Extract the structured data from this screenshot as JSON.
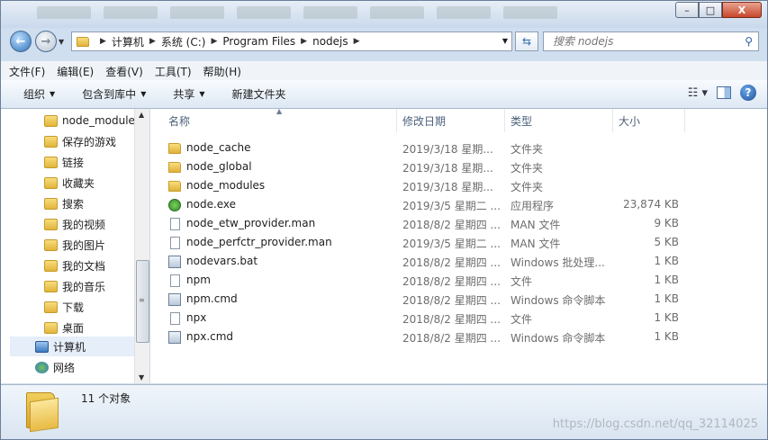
{
  "window": {
    "caption_buttons": [
      "–",
      "□",
      "X"
    ]
  },
  "address": {
    "crumbs": [
      "计算机",
      "系统 (C:)",
      "Program Files",
      "nodejs"
    ],
    "search_placeholder": "搜索 nodejs"
  },
  "menu": [
    "文件(F)",
    "编辑(E)",
    "查看(V)",
    "工具(T)",
    "帮助(H)"
  ],
  "toolbar": {
    "organize": "组织",
    "include_library": "包含到库中",
    "share": "共享",
    "new_folder": "新建文件夹"
  },
  "nav": {
    "items": [
      {
        "label": "node_module",
        "icon": "folder-icon"
      },
      {
        "label": "保存的游戏",
        "icon": "folder-icon"
      },
      {
        "label": "链接",
        "icon": "folder-icon"
      },
      {
        "label": "收藏夹",
        "icon": "folder-icon"
      },
      {
        "label": "搜索",
        "icon": "folder-icon"
      },
      {
        "label": "我的视频",
        "icon": "folder-icon"
      },
      {
        "label": "我的图片",
        "icon": "folder-icon"
      },
      {
        "label": "我的文档",
        "icon": "folder-icon"
      },
      {
        "label": "我的音乐",
        "icon": "folder-icon"
      },
      {
        "label": "下载",
        "icon": "folder-icon"
      },
      {
        "label": "桌面",
        "icon": "folder-icon"
      },
      {
        "label": "计算机",
        "icon": "computer-icon"
      },
      {
        "label": "网络",
        "icon": "network-icon"
      }
    ]
  },
  "columns": {
    "name": "名称",
    "date": "修改日期",
    "type": "类型",
    "size": "大小"
  },
  "files": [
    {
      "name": "node_cache",
      "date": "2019/3/18 星期...",
      "type": "文件夹",
      "size": "",
      "icon": "folder"
    },
    {
      "name": "node_global",
      "date": "2019/3/18 星期...",
      "type": "文件夹",
      "size": "",
      "icon": "folder"
    },
    {
      "name": "node_modules",
      "date": "2019/3/18 星期...",
      "type": "文件夹",
      "size": "",
      "icon": "folder"
    },
    {
      "name": "node.exe",
      "date": "2019/3/5 星期二 ...",
      "type": "应用程序",
      "size": "23,874 KB",
      "icon": "exe"
    },
    {
      "name": "node_etw_provider.man",
      "date": "2018/8/2 星期四 ...",
      "type": "MAN 文件",
      "size": "9 KB",
      "icon": "file"
    },
    {
      "name": "node_perfctr_provider.man",
      "date": "2019/3/5 星期二 ...",
      "type": "MAN 文件",
      "size": "5 KB",
      "icon": "file"
    },
    {
      "name": "nodevars.bat",
      "date": "2018/8/2 星期四 ...",
      "type": "Windows 批处理...",
      "size": "1 KB",
      "icon": "bat"
    },
    {
      "name": "npm",
      "date": "2018/8/2 星期四 ...",
      "type": "文件",
      "size": "1 KB",
      "icon": "file"
    },
    {
      "name": "npm.cmd",
      "date": "2018/8/2 星期四 ...",
      "type": "Windows 命令脚本",
      "size": "1 KB",
      "icon": "bat"
    },
    {
      "name": "npx",
      "date": "2018/8/2 星期四 ...",
      "type": "文件",
      "size": "1 KB",
      "icon": "file"
    },
    {
      "name": "npx.cmd",
      "date": "2018/8/2 星期四 ...",
      "type": "Windows 命令脚本",
      "size": "1 KB",
      "icon": "bat"
    }
  ],
  "status": {
    "count": "11 个对象"
  },
  "watermark": "https://blog.csdn.net/qq_32114025"
}
